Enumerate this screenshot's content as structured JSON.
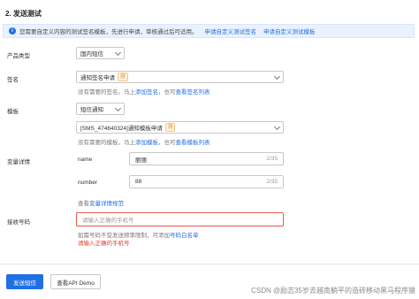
{
  "section": {
    "title": "2. 发送测试"
  },
  "notice": {
    "message": "您需要自定义内容的测试签名模板，先进行申请，审核通过后可适用。",
    "link_signature": "申请自定义测试签名",
    "link_template": "申请自定义测试模板"
  },
  "product_type": {
    "label": "产品类型",
    "value": "国内短信"
  },
  "signature": {
    "label": "签名",
    "value": "通知签名申请",
    "tag": "测",
    "hint": "没有需要的签名，马上",
    "hint_link_add": "添加签名",
    "hint_mid": "，也可",
    "hint_link_list": "查看签名列表"
  },
  "template": {
    "label": "模板",
    "type_value": "短信通知",
    "value": "[SMS_474640324]通知模板申请",
    "tag": "测",
    "hint": "没有需要的模板，马上",
    "hint_link_add": "添加模板",
    "hint_mid": "，也可",
    "hint_link_list": "查看模板列表"
  },
  "variables": {
    "label": "变量详情",
    "rows": [
      {
        "name": "name",
        "value": "丽丽",
        "count": "2/35"
      },
      {
        "name": "number",
        "value": "88",
        "count": "2/35"
      }
    ],
    "spec_prefix": "查看",
    "spec_link": "变量详情规范"
  },
  "phone": {
    "label": "接收号码",
    "placeholder": "请输入正确的手机号",
    "hint": "如需号码不受发送频率限制，可添加",
    "hint_link": "号码白名单",
    "error": "请输入正确的手机号"
  },
  "actions": {
    "send": "发送短信",
    "view_api": "查看API Demo"
  },
  "watermark": "CSDN @励志35岁去越南躺平的造砖移动黑马程序猿"
}
